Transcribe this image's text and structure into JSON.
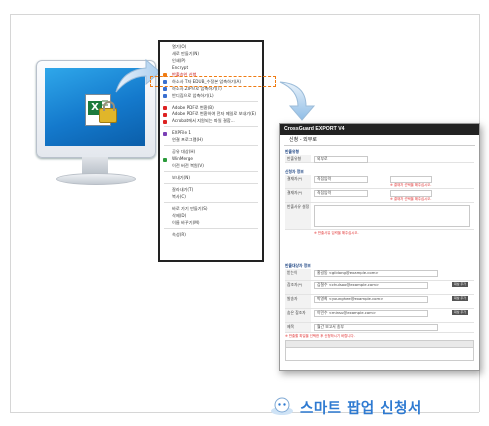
{
  "menu": {
    "items": [
      {
        "label": "열기(O)",
        "icon": "none"
      },
      {
        "label": "새로 만들기(N)",
        "icon": "none"
      },
      {
        "label": "인쇄(P)",
        "icon": "none"
      },
      {
        "label": "Encrypt",
        "icon": "none"
      },
      {
        "label": "반출승인 신청",
        "icon": "orange",
        "highlight": true
      },
      {
        "label": "하소사 T자 EDUB_수정본 압축하기(A)",
        "icon": "blue"
      },
      {
        "label": "하소사.ZIP으로 압축하기(T)",
        "icon": "blue"
      },
      {
        "label": "반디집으로 압축하기(L)",
        "icon": "blue"
      },
      {
        "label": "",
        "sep": true
      },
      {
        "label": "Adobe PDF로 변환(B)",
        "icon": "red"
      },
      {
        "label": "Adobe PDF로 변환하여 전자 메일로 보내기(E)",
        "icon": "red"
      },
      {
        "label": "Acrobat에서 지원되는 파일 결합...",
        "icon": "red"
      },
      {
        "label": "",
        "sep": true
      },
      {
        "label": "EXPFile 1",
        "icon": "purple"
      },
      {
        "label": "연결 프로그램(H)",
        "icon": "none"
      },
      {
        "label": "",
        "sep": true
      },
      {
        "label": "공유 대상(H)",
        "icon": "none"
      },
      {
        "label": "WinMerge",
        "icon": "green"
      },
      {
        "label": "이전 버전 복원(V)",
        "icon": "none"
      },
      {
        "label": "",
        "sep": true
      },
      {
        "label": "보내기(N)",
        "icon": "none"
      },
      {
        "label": "",
        "sep": true
      },
      {
        "label": "잘라내기(T)",
        "icon": "none"
      },
      {
        "label": "복사(C)",
        "icon": "none"
      },
      {
        "label": "",
        "sep": true
      },
      {
        "label": "바로 가기 만들기(S)",
        "icon": "none"
      },
      {
        "label": "삭제(D)",
        "icon": "none"
      },
      {
        "label": "이름 바꾸기(M)",
        "icon": "none"
      },
      {
        "label": "",
        "sep": true
      },
      {
        "label": "속성(R)",
        "icon": "none"
      }
    ]
  },
  "form": {
    "title": "CrossGuard EXPORT V4",
    "subtitle": "신청 - 외부로",
    "section1": {
      "heading": "반출유형",
      "label": "반출유형",
      "value": "외부로"
    },
    "section2": {
      "heading": "신청자 정보",
      "rows": [
        {
          "label": "결재자(*)",
          "value": "직접입력",
          "warn": "※ 결재자 선택을 해주십시오."
        },
        {
          "label": "결재자(*)",
          "value": "직접입력",
          "warn": "※ 결재자 선택을 해주십시오."
        },
        {
          "label": "반출사유 설정",
          "value": ""
        }
      ],
      "note": "※ 반출사유 입력을 해주십시오."
    },
    "section3": {
      "heading": "반출대상자 정보",
      "rows": [
        {
          "label": "받는이",
          "value": "홍길동 <gildong@example.com>"
        },
        {
          "label": "참조자(*)",
          "value": "김철수 <chulsoo@example.com>",
          "btn": "대상 추가"
        },
        {
          "label": "발송자",
          "value": "박영희 <younghee@example.com>",
          "btn": "대상 추가"
        },
        {
          "label": "숨은 참조자",
          "value": "이민수 <minsu@example.com>",
          "btn": "대상 추가"
        },
        {
          "label": "제목",
          "value": "월간 보고서 송부"
        }
      ],
      "note": "※ 반출할 파일을 선택한 후 신청하시기 바랍니다."
    }
  },
  "slogan": "스마트 팝업 신청서",
  "colors": {
    "accent": "#ef7b12",
    "brand": "#2e7ad1",
    "titlebar": "#222222"
  }
}
